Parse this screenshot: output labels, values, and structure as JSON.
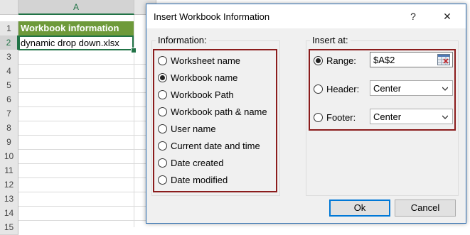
{
  "sheet": {
    "column_header": "A",
    "rows": [
      "1",
      "2",
      "3",
      "4",
      "5",
      "6",
      "7",
      "8",
      "9",
      "10",
      "11",
      "12",
      "13",
      "14",
      "15"
    ],
    "cells": {
      "a1": "Workbook information",
      "a2": "dynamic drop down.xlsx"
    }
  },
  "dialog": {
    "title": "Insert Workbook Information",
    "help_label": "?",
    "close_label": "✕",
    "information": {
      "group_label": "Information:",
      "options": [
        {
          "label": "Worksheet name",
          "checked": false
        },
        {
          "label": "Workbook name",
          "checked": true
        },
        {
          "label": "Workbook Path",
          "checked": false
        },
        {
          "label": "Workbook path & name",
          "checked": false
        },
        {
          "label": "User name",
          "checked": false
        },
        {
          "label": "Current date and time",
          "checked": false
        },
        {
          "label": "Date created",
          "checked": false
        },
        {
          "label": "Date modified",
          "checked": false
        }
      ]
    },
    "insert_at": {
      "group_label": "Insert at:",
      "range": {
        "label": "Range:",
        "checked": true,
        "value": "$A$2"
      },
      "header": {
        "label": "Header:",
        "checked": false,
        "value": "Center"
      },
      "footer": {
        "label": "Footer:",
        "checked": false,
        "value": "Center"
      }
    },
    "ok_label": "Ok",
    "cancel_label": "Cancel"
  },
  "colors": {
    "header_fill": "#6e9a3a",
    "highlight_box": "#8b1c1c",
    "selection": "#217346"
  }
}
